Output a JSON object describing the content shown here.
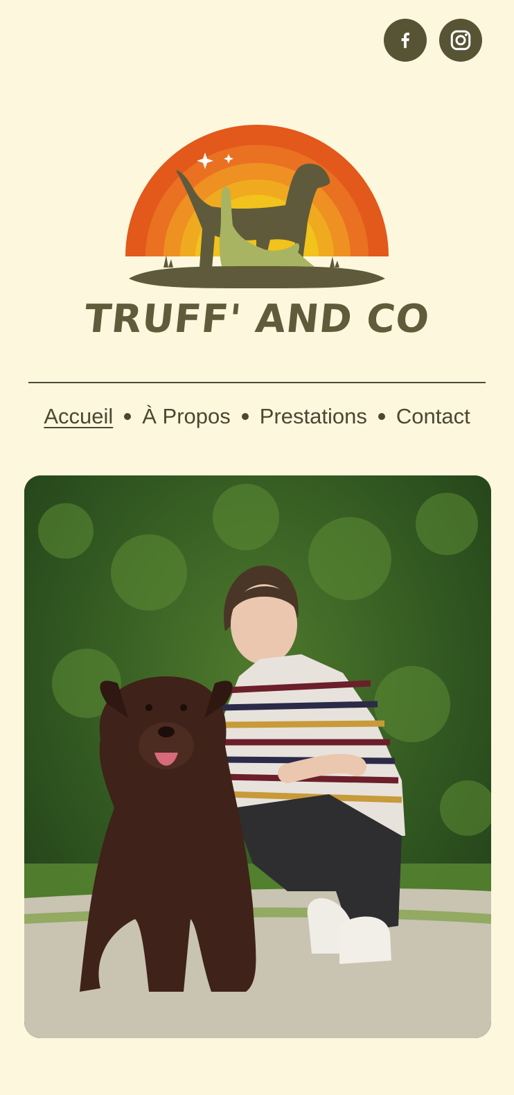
{
  "social": [
    {
      "name": "facebook",
      "icon": "facebook-icon"
    },
    {
      "name": "instagram",
      "icon": "instagram-icon"
    }
  ],
  "brand": {
    "name": "TRUFF' AND CO"
  },
  "nav": {
    "items": [
      {
        "label": "Accueil",
        "active": true
      },
      {
        "label": "À Propos",
        "active": false
      },
      {
        "label": "Prestations",
        "active": false
      },
      {
        "label": "Contact",
        "active": false
      }
    ]
  },
  "colors": {
    "background": "#fdf7dd",
    "olive": "#575436",
    "orange": "#e05a1a",
    "yellow": "#f2c21d",
    "green": "#a9b462"
  },
  "hero": {
    "image": "woman-with-chocolate-labrador-photo"
  }
}
